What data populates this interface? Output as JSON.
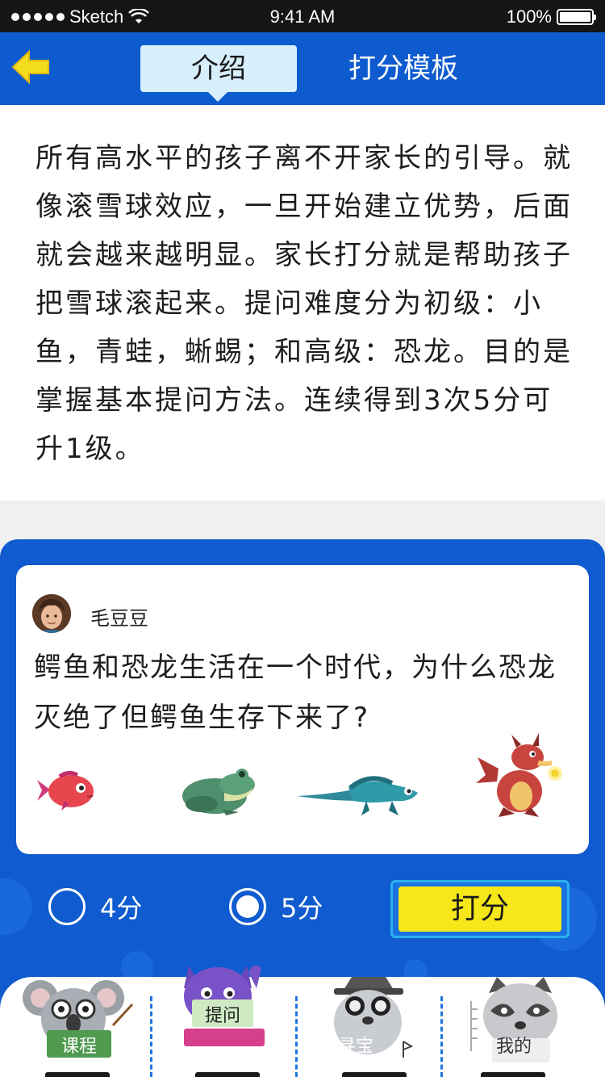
{
  "status_bar": {
    "carrier": "Sketch",
    "time": "9:41 AM",
    "battery": "100%"
  },
  "nav": {
    "tab_intro": "介绍",
    "tab_template": "打分模板",
    "back_icon": "arrow-left-icon"
  },
  "intro": {
    "text": "所有高水平的孩子离不开家长的引导。就像滚雪球效应，一旦开始建立优势，后面就会越来越明显。家长打分就是帮助孩子把雪球滚起来。提问难度分为初级：小鱼，青蛙，蜥蜴；和高级：恐龙。目的是掌握基本提问方法。连续得到3次5分可升1级。"
  },
  "card": {
    "username": "毛豆豆",
    "question": "鳄鱼和恐龙生活在一个时代，为什么恐龙灭绝了但鳄鱼生存下来了?",
    "levels": [
      "fish-icon",
      "frog-icon",
      "lizard-icon",
      "dragon-icon"
    ]
  },
  "rating": {
    "options": [
      {
        "label": "4分",
        "selected": false
      },
      {
        "label": "5分",
        "selected": true
      }
    ],
    "submit_label": "打分"
  },
  "tabbar": {
    "items": [
      {
        "label": "课程",
        "icon": "koala-icon"
      },
      {
        "label": "提问",
        "icon": "cat-icon"
      },
      {
        "label": "寻宝",
        "icon": "dog-icon"
      },
      {
        "label": "我的",
        "icon": "raccoon-icon"
      }
    ]
  },
  "colors": {
    "primary_blue": "#0e5bd0",
    "tab_highlight": "#d7eefb",
    "button_yellow": "#f5e71a"
  }
}
